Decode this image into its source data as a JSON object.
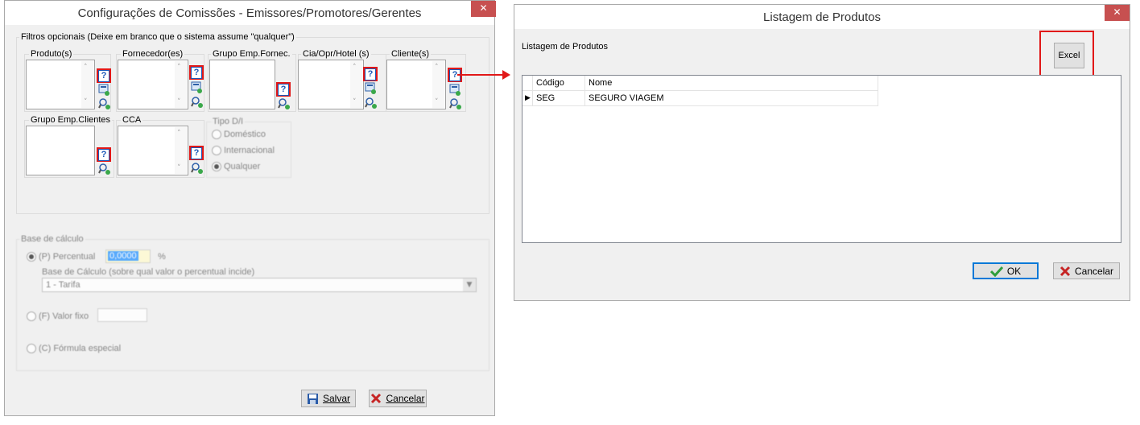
{
  "left_window": {
    "title": "Configurações de Comissões - Emissores/Promotores/Gerentes",
    "close_glyph": "✕",
    "filters_legend": "Filtros opcionais (Deixe em branco que o sistema assume \"qualquer\")",
    "filter_boxes": [
      {
        "label": "Produto(s)"
      },
      {
        "label": "Fornecedor(es)"
      },
      {
        "label": "Grupo Emp.Fornec."
      },
      {
        "label": "Cia/Opr/Hotel (s)"
      },
      {
        "label": "Cliente(s)"
      },
      {
        "label": "Grupo Emp.Clientes"
      },
      {
        "label": "CCA"
      }
    ],
    "help_glyph": "?",
    "tipo": {
      "legend": "Tipo D/I",
      "options": [
        "Doméstico",
        "Internacional",
        "Qualquer"
      ],
      "selected": "Qualquer"
    },
    "base": {
      "legend": "Base de cálculo",
      "percentual_label": "(P) Percentual",
      "percentual_value": "0,0000",
      "percent_sign": "%",
      "base_calc_label": "Base de Cálculo (sobre qual valor o percentual incide)",
      "base_calc_value": "1 - Tarifa",
      "valor_fixo_label": "(F) Valor fixo",
      "formula_label": "(C) Fórmula especial"
    },
    "buttons": {
      "save_label": "Salvar",
      "cancel_label": "Cancelar"
    }
  },
  "right_window": {
    "title": "Listagem de Produtos",
    "close_glyph": "✕",
    "subtitle": "Listagem de Produtos",
    "excel_label": "Excel",
    "columns": [
      "Código",
      "Nome"
    ],
    "rows": [
      {
        "codigo": "SEG",
        "nome": "SEGURO VIAGEM"
      }
    ],
    "ok_label": "OK",
    "cancel_label": "Cancelar"
  },
  "colors": {
    "highlight_red": "#e11818",
    "close_red": "#c75050",
    "accent_blue": "#0078d7"
  },
  "icons": [
    "help-icon",
    "select-list-icon",
    "search-add-icon",
    "save-icon",
    "cancel-x-icon",
    "check-icon",
    "arrow-right-icon"
  ]
}
